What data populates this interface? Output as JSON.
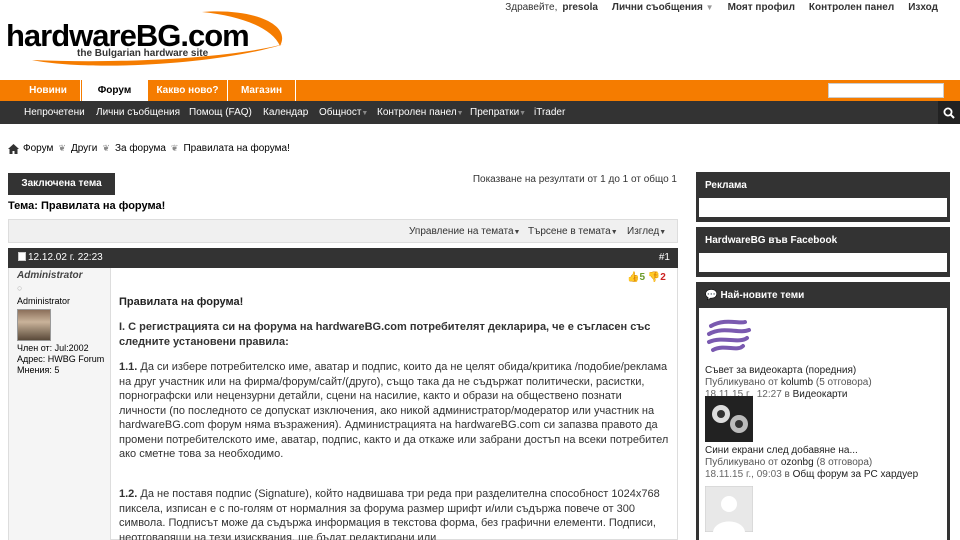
{
  "header": {
    "logo_main": "hardwareBG.com",
    "logo_sub": "the Bulgarian hardware site",
    "greeting": "Здравейте,",
    "username": "presola",
    "user_links": [
      "Лични съобщения",
      "Моят профил",
      "Контролен панел",
      "Изход"
    ]
  },
  "topnav": {
    "tabs": [
      "Новини",
      "Форум",
      "Какво ново?",
      "Магазин"
    ]
  },
  "subnav": {
    "items": [
      "Непрочетени",
      "Лични съобщения",
      "Помощ (FAQ)",
      "Календар",
      "Общност",
      "Контролен панел",
      "Препратки",
      "iTrader"
    ]
  },
  "breadcrumb": [
    "Форум",
    "Други",
    "За форума",
    "Правилата на форума!"
  ],
  "thread": {
    "closed_label": "Заключена тема",
    "results": "Показване на резултати от 1 до 1 от общо 1",
    "title": "Тема: Правилата на форума!",
    "tools": [
      "Управление на темата",
      "Търсене в темата",
      "Изглед"
    ]
  },
  "post": {
    "date": "12.12.02 г. 22:23",
    "number": "#1",
    "votes_up": "5",
    "votes_down": "2",
    "title": "Правилата на форума!",
    "intro": "I. С регистрацията си на форума на hardwareBG.com потребителят декларира, че е съгласен със следните установени правила:",
    "p1_num": "1.1.",
    "p1": "Да си избере потребителско име, аватар и подпис, които да не целят обида/критика /подобие/реклама на друг участник или на фирма/форум/сайт/(друго), също така да не съдържат политически, расистки, порнографски или нецензурни детайли, сцени на насилие, както и образи на обществено познати личности (по последното се допускат изключения, ако никой администратор/модератор или участник на hardwareBG.com форум няма възражения). Администрацията на hardwareBG.com си запазва правото да промени потребителското име, аватар, подпис, както и да откаже или забрани достъп на всеки потребител ако сметне това за необходимо.",
    "p2_num": "1.2.",
    "p2": "Да не поставя подпис (Signature), който надвишава три реда при разделителна способност 1024x768 пиксела, изписан е с по-голям от нормалния за форума размер шрифт и/или съдържа повече от 300 символа. Подписът може да съдържа информация в текстова форма, без графични елементи. Подписи, неотговарящи на тези изисквания, ще бъдат редактирани или"
  },
  "user": {
    "name": "Administrator",
    "status": "○",
    "title": "Administrator",
    "joined": "Член от: Jul:2002",
    "address": "Адрес: HWBG Forum",
    "posts": "Мнения: 5"
  },
  "sidebar": {
    "ads_title": "Реклама",
    "facebook_title": "HardwareBG във Facebook",
    "latest_title": "Най-новите теми",
    "topics": [
      {
        "title": "Съвет за видеокарта (поредния)",
        "by_prefix": "Публикувано от",
        "author": "kolumb",
        "replies": "(5 отговора)",
        "date": "18.11.15 г.,",
        "time": "12:27",
        "in": "в",
        "forum": "Видеокарти"
      },
      {
        "title": "Сини екрани след добавяне на...",
        "by_prefix": "Публикувано от",
        "author": "ozonbg",
        "replies": "(8 отговора)",
        "date": "18.11.15 г.,",
        "time": "09:03",
        "in": "в",
        "forum": "Общ форум за PC хардуер"
      }
    ]
  },
  "colors": {
    "orange": "#f57c00",
    "dark": "#333333"
  }
}
